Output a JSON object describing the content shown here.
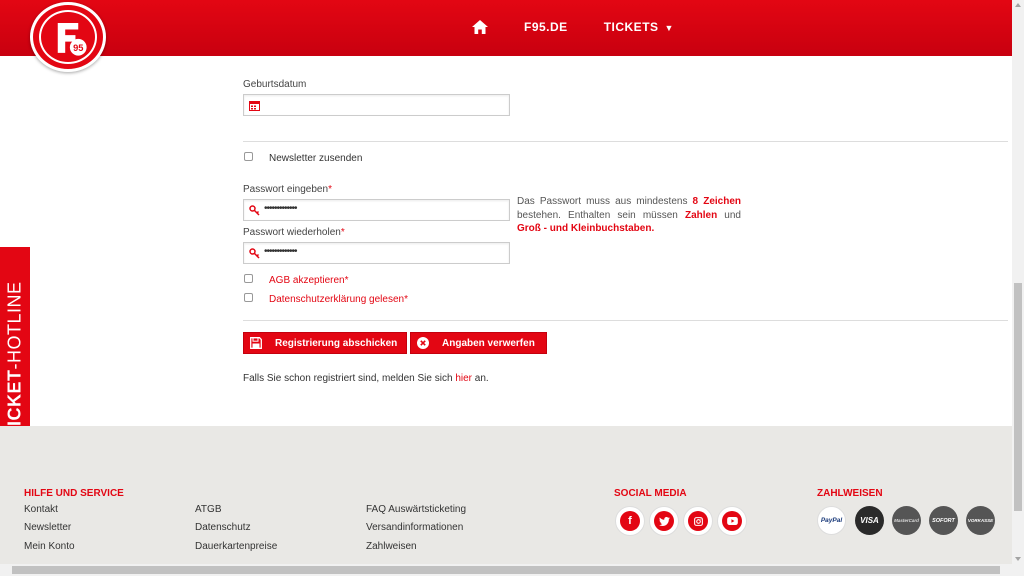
{
  "header": {
    "logo_text": "F95",
    "nav": [
      {
        "label": "F95.DE"
      },
      {
        "label": "TICKETS"
      }
    ]
  },
  "hotline": {
    "bold": "TICKET",
    "rest": "-HOTLINE"
  },
  "form": {
    "birthdate_label": "Geburtsdatum",
    "birthdate_value": "",
    "newsletter_label": "Newsletter zusenden",
    "password_label": "Passwort eingeben",
    "password_value": "•••••••••••••",
    "password_repeat_label": "Passwort wiederholen",
    "password_repeat_value": "•••••••••••••",
    "required_mark": "*",
    "agb_label": "AGB akzeptieren",
    "privacy_label": "Datenschutzerklärung gelesen",
    "hint_part1": "Das Passwort muss aus mindestens ",
    "hint_bold1": "8 Zeichen",
    "hint_part2": " bestehen. Enthalten sein müssen ",
    "hint_bold2": "Zahlen",
    "hint_part3": " und ",
    "hint_bold3": "Groß - und Kleinbuchstaben.",
    "submit_label": "Registrierung abschicken",
    "discard_label": "Angaben verwerfen",
    "login_prefix": "Falls Sie schon registriert sind, melden Sie sich ",
    "login_link": "hier",
    "login_suffix": " an."
  },
  "footer": {
    "service_heading": "HILFE UND SERVICE",
    "col1": [
      "Kontakt",
      "Newsletter",
      "Mein Konto"
    ],
    "col2": [
      "ATGB",
      "Datenschutz",
      "Dauerkartenpreise"
    ],
    "col3": [
      "FAQ Auswärtsticketing",
      "Versandinformationen",
      "Zahlweisen"
    ],
    "social_heading": "SOCIAL MEDIA",
    "social": [
      "f",
      "twitter",
      "instagram",
      "youtube"
    ],
    "payment_heading": "ZAHLWEISEN",
    "payments": [
      "PayPal",
      "VISA",
      "MasterCard",
      "SOFORT",
      "VORKASSE"
    ]
  },
  "colors": {
    "accent": "#e30613",
    "footer_bg": "#e9e8e5"
  }
}
